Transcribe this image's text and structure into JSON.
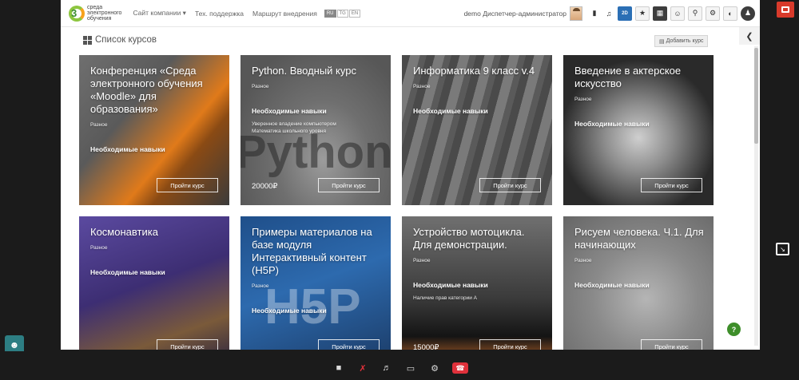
{
  "header": {
    "logo_line1": "среда",
    "logo_line2": "электронного",
    "logo_line3": "обучения",
    "logo_mark": "3",
    "nav": [
      "Сайт компании ▾",
      "Тех. поддержка",
      "Маршрут внедрения"
    ],
    "langs": [
      "RU",
      "TG",
      "EN"
    ],
    "user_label": "demo Диспетчер-администратор",
    "badge_2d": "2D"
  },
  "page": {
    "title": "Список курсов",
    "add_course": "Добавить курс"
  },
  "courses": [
    {
      "title": "Конференция «Среда электронного обучения «Moodle» для образования»",
      "category": "Разное",
      "skills": "Необходимые навыки",
      "skills_desc": "",
      "price": "",
      "button": "Пройти курс"
    },
    {
      "title": "Python. Вводный курс",
      "category": "Разное",
      "skills": "Необходимые навыки",
      "skills_desc": "Уверенное владение компьютером Математика школьного уровня",
      "price": "20000₽",
      "button": "Пройти курс"
    },
    {
      "title": "Информатика 9 класс v.4",
      "category": "Разное",
      "skills": "Необходимые навыки",
      "skills_desc": "",
      "price": "",
      "button": "Пройти курс"
    },
    {
      "title": "Введение в актерское искусство",
      "category": "Разное",
      "skills": "Необходимые навыки",
      "skills_desc": "",
      "price": "",
      "button": "Пройти курс"
    },
    {
      "title": "Космонавтика",
      "category": "Разное",
      "skills": "Необходимые навыки",
      "skills_desc": "",
      "price": "",
      "button": "Пройти курс"
    },
    {
      "title": "Примеры материалов на базе модуля Интерактивный контент (H5P)",
      "category": "Разное",
      "skills": "Необходимые навыки",
      "skills_desc": "",
      "price": "",
      "button": "Пройти курс"
    },
    {
      "title": "Устройство мотоцикла. Для демонстрации.",
      "category": "Разное",
      "skills": "Необходимые навыки",
      "skills_desc": "Наличие прав категории А",
      "price": "15000₽",
      "button": "Пройти курс"
    },
    {
      "title": "Рисуем человека. Ч.1. Для начинающих",
      "category": "Разное",
      "skills": "Необходимые навыки",
      "skills_desc": "",
      "price": "",
      "button": "Пройти курс"
    }
  ],
  "decor": {
    "python_word": "Python",
    "h5p_word": "H5P"
  },
  "help_label": "?",
  "colors": {
    "accent_green": "#3e8e2a",
    "hangup_red": "#e0313b",
    "rec_red": "#d83a2b"
  }
}
